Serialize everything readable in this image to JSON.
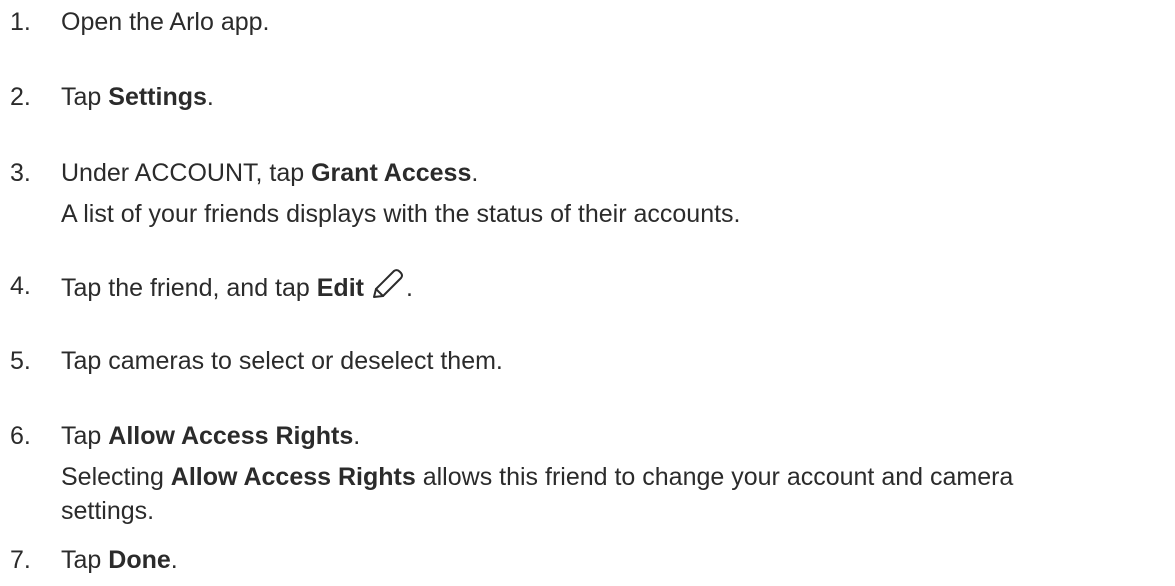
{
  "steps": [
    {
      "num": "1.",
      "parts": [
        {
          "t": "Open the Arlo app.",
          "b": false
        }
      ]
    },
    {
      "num": "2.",
      "parts": [
        {
          "t": "Tap ",
          "b": false
        },
        {
          "t": "Settings",
          "b": true
        },
        {
          "t": ".",
          "b": false
        }
      ]
    },
    {
      "num": "3.",
      "parts": [
        {
          "t": "Under ACCOUNT, tap ",
          "b": false
        },
        {
          "t": "Grant Access",
          "b": true
        },
        {
          "t": ".",
          "b": false
        }
      ],
      "sub": [
        {
          "t": "A list of your friends displays with the status of their accounts.",
          "b": false
        }
      ]
    },
    {
      "num": "4.",
      "parts": [
        {
          "t": "Tap the friend, and tap ",
          "b": false
        },
        {
          "t": "Edit",
          "b": true
        },
        {
          "icon": "pencil-icon"
        },
        {
          "t": ".",
          "b": false
        }
      ]
    },
    {
      "num": "5.",
      "parts": [
        {
          "t": "Tap cameras to select or deselect them.",
          "b": false
        }
      ]
    },
    {
      "num": "6.",
      "parts": [
        {
          "t": "Tap ",
          "b": false
        },
        {
          "t": "Allow Access Rights",
          "b": true
        },
        {
          "t": ".",
          "b": false
        }
      ],
      "sub": [
        {
          "t": "Selecting ",
          "b": false
        },
        {
          "t": "Allow Access Rights",
          "b": true
        },
        {
          "t": " allows this friend to change your account and camera",
          "b": false
        }
      ],
      "sub2": [
        {
          "t": "settings.",
          "b": false
        }
      ]
    },
    {
      "num": "7.",
      "parts": [
        {
          "t": "Tap ",
          "b": false
        },
        {
          "t": "Done",
          "b": true
        },
        {
          "t": ".",
          "b": false
        }
      ]
    }
  ]
}
